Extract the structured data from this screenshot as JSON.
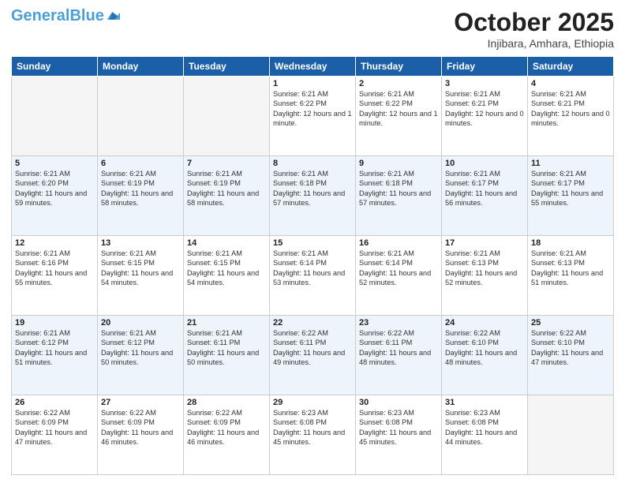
{
  "header": {
    "logo_general": "General",
    "logo_blue": "Blue",
    "month_title": "October 2025",
    "location": "Injibara, Amhara, Ethiopia"
  },
  "days_of_week": [
    "Sunday",
    "Monday",
    "Tuesday",
    "Wednesday",
    "Thursday",
    "Friday",
    "Saturday"
  ],
  "weeks": [
    [
      {
        "day": "",
        "info": ""
      },
      {
        "day": "",
        "info": ""
      },
      {
        "day": "",
        "info": ""
      },
      {
        "day": "1",
        "info": "Sunrise: 6:21 AM\nSunset: 6:22 PM\nDaylight: 12 hours and 1 minute."
      },
      {
        "day": "2",
        "info": "Sunrise: 6:21 AM\nSunset: 6:22 PM\nDaylight: 12 hours and 1 minute."
      },
      {
        "day": "3",
        "info": "Sunrise: 6:21 AM\nSunset: 6:21 PM\nDaylight: 12 hours and 0 minutes."
      },
      {
        "day": "4",
        "info": "Sunrise: 6:21 AM\nSunset: 6:21 PM\nDaylight: 12 hours and 0 minutes."
      }
    ],
    [
      {
        "day": "5",
        "info": "Sunrise: 6:21 AM\nSunset: 6:20 PM\nDaylight: 11 hours and 59 minutes."
      },
      {
        "day": "6",
        "info": "Sunrise: 6:21 AM\nSunset: 6:19 PM\nDaylight: 11 hours and 58 minutes."
      },
      {
        "day": "7",
        "info": "Sunrise: 6:21 AM\nSunset: 6:19 PM\nDaylight: 11 hours and 58 minutes."
      },
      {
        "day": "8",
        "info": "Sunrise: 6:21 AM\nSunset: 6:18 PM\nDaylight: 11 hours and 57 minutes."
      },
      {
        "day": "9",
        "info": "Sunrise: 6:21 AM\nSunset: 6:18 PM\nDaylight: 11 hours and 57 minutes."
      },
      {
        "day": "10",
        "info": "Sunrise: 6:21 AM\nSunset: 6:17 PM\nDaylight: 11 hours and 56 minutes."
      },
      {
        "day": "11",
        "info": "Sunrise: 6:21 AM\nSunset: 6:17 PM\nDaylight: 11 hours and 55 minutes."
      }
    ],
    [
      {
        "day": "12",
        "info": "Sunrise: 6:21 AM\nSunset: 6:16 PM\nDaylight: 11 hours and 55 minutes."
      },
      {
        "day": "13",
        "info": "Sunrise: 6:21 AM\nSunset: 6:15 PM\nDaylight: 11 hours and 54 minutes."
      },
      {
        "day": "14",
        "info": "Sunrise: 6:21 AM\nSunset: 6:15 PM\nDaylight: 11 hours and 54 minutes."
      },
      {
        "day": "15",
        "info": "Sunrise: 6:21 AM\nSunset: 6:14 PM\nDaylight: 11 hours and 53 minutes."
      },
      {
        "day": "16",
        "info": "Sunrise: 6:21 AM\nSunset: 6:14 PM\nDaylight: 11 hours and 52 minutes."
      },
      {
        "day": "17",
        "info": "Sunrise: 6:21 AM\nSunset: 6:13 PM\nDaylight: 11 hours and 52 minutes."
      },
      {
        "day": "18",
        "info": "Sunrise: 6:21 AM\nSunset: 6:13 PM\nDaylight: 11 hours and 51 minutes."
      }
    ],
    [
      {
        "day": "19",
        "info": "Sunrise: 6:21 AM\nSunset: 6:12 PM\nDaylight: 11 hours and 51 minutes."
      },
      {
        "day": "20",
        "info": "Sunrise: 6:21 AM\nSunset: 6:12 PM\nDaylight: 11 hours and 50 minutes."
      },
      {
        "day": "21",
        "info": "Sunrise: 6:21 AM\nSunset: 6:11 PM\nDaylight: 11 hours and 50 minutes."
      },
      {
        "day": "22",
        "info": "Sunrise: 6:22 AM\nSunset: 6:11 PM\nDaylight: 11 hours and 49 minutes."
      },
      {
        "day": "23",
        "info": "Sunrise: 6:22 AM\nSunset: 6:11 PM\nDaylight: 11 hours and 48 minutes."
      },
      {
        "day": "24",
        "info": "Sunrise: 6:22 AM\nSunset: 6:10 PM\nDaylight: 11 hours and 48 minutes."
      },
      {
        "day": "25",
        "info": "Sunrise: 6:22 AM\nSunset: 6:10 PM\nDaylight: 11 hours and 47 minutes."
      }
    ],
    [
      {
        "day": "26",
        "info": "Sunrise: 6:22 AM\nSunset: 6:09 PM\nDaylight: 11 hours and 47 minutes."
      },
      {
        "day": "27",
        "info": "Sunrise: 6:22 AM\nSunset: 6:09 PM\nDaylight: 11 hours and 46 minutes."
      },
      {
        "day": "28",
        "info": "Sunrise: 6:22 AM\nSunset: 6:09 PM\nDaylight: 11 hours and 46 minutes."
      },
      {
        "day": "29",
        "info": "Sunrise: 6:23 AM\nSunset: 6:08 PM\nDaylight: 11 hours and 45 minutes."
      },
      {
        "day": "30",
        "info": "Sunrise: 6:23 AM\nSunset: 6:08 PM\nDaylight: 11 hours and 45 minutes."
      },
      {
        "day": "31",
        "info": "Sunrise: 6:23 AM\nSunset: 6:08 PM\nDaylight: 11 hours and 44 minutes."
      },
      {
        "day": "",
        "info": ""
      }
    ]
  ]
}
